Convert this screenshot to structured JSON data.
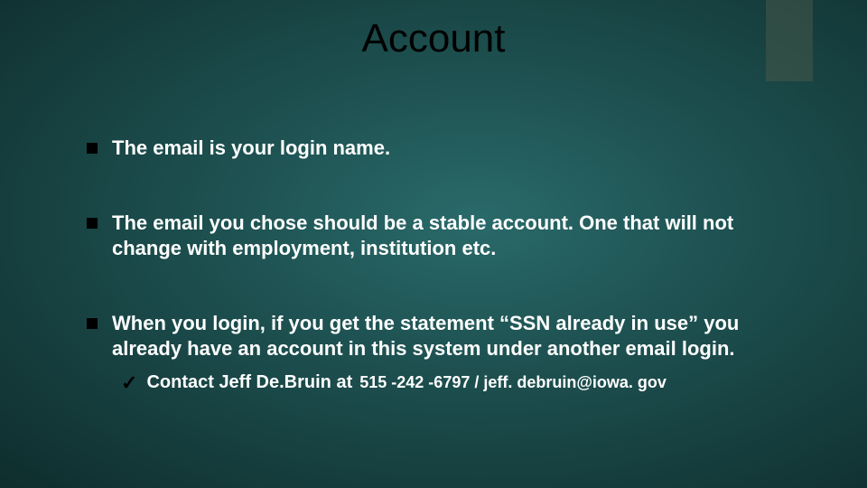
{
  "slide": {
    "title": "Account",
    "bullets": [
      "The email is your login name.",
      "The email you chose should be a stable account. One that will not change with employment, institution etc.",
      "When you login, if you get the statement “SSN already in use” you already have an account in this system under another email login."
    ],
    "sub_bullet": {
      "prefix": "Contact Jeff De.Bruin at",
      "detail": "515 -242 -6797 / jeff. debruin@iowa. gov"
    }
  }
}
